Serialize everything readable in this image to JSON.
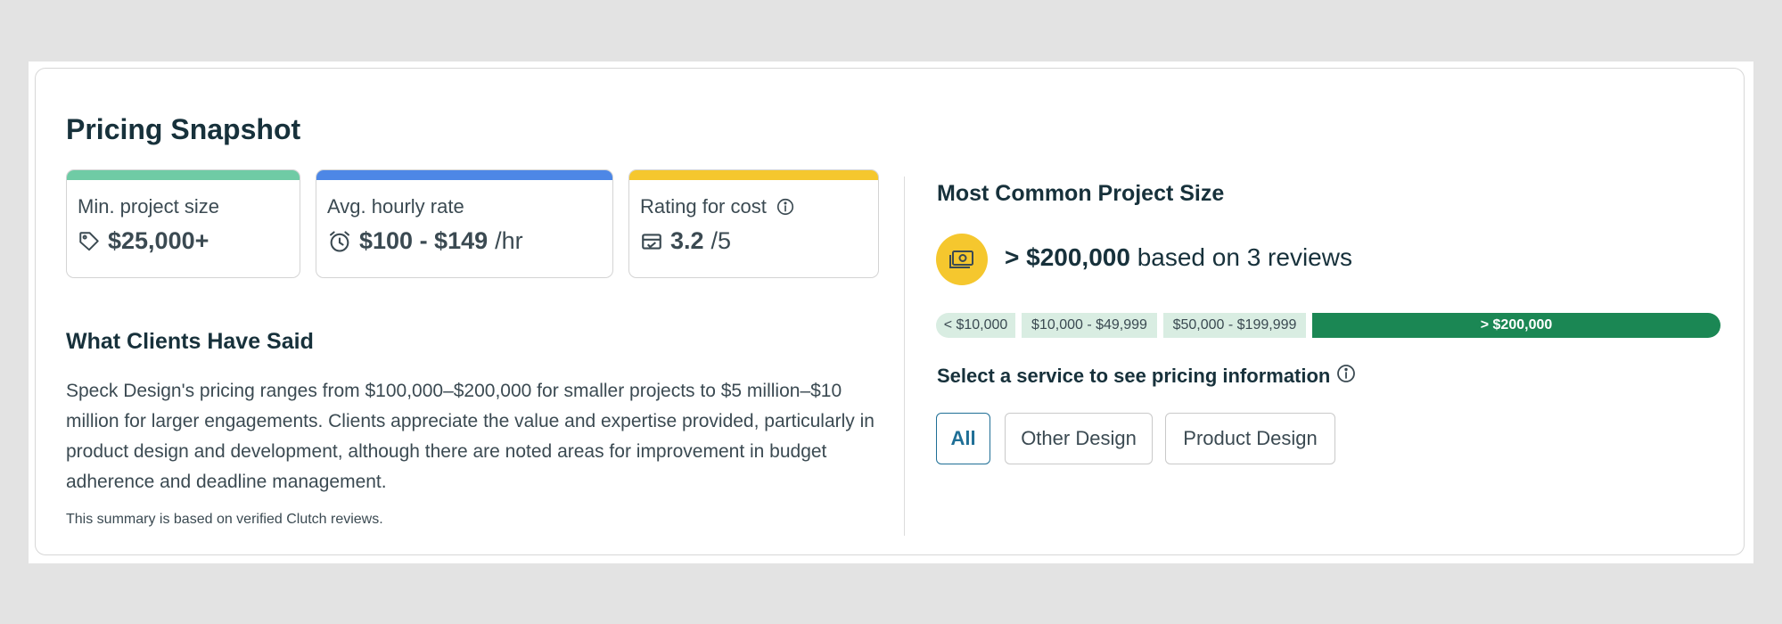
{
  "title": "Pricing Snapshot",
  "stats": [
    {
      "label": "Min. project size",
      "icon": "tag-icon",
      "value": "$25,000+",
      "suffix": "",
      "bar_color": "#6fcba5"
    },
    {
      "label": "Avg. hourly rate",
      "icon": "clock-icon",
      "value": "$100 - $149",
      "suffix": "/hr",
      "bar_color": "#4d87e6"
    },
    {
      "label": "Rating for cost",
      "icon": "wallet-icon",
      "info_icon": "info-icon",
      "value": "3.2",
      "suffix": "/5",
      "bar_color": "#f5c72e"
    }
  ],
  "clients": {
    "heading": "What Clients Have Said",
    "summary": "Speck Design's pricing ranges from $100,000–$200,000 for smaller projects to $5 million–$10 million for larger engagements. Clients appreciate the value and expertise provided, particularly in product design and development, although there are noted areas for improvement in budget adherence and deadline management.",
    "footnote": "This summary is based on verified Clutch reviews."
  },
  "common_size": {
    "heading": "Most Common Project Size",
    "icon": "money-icon",
    "value": "> $200,000",
    "text": "based on 3 reviews",
    "ranges": [
      "< $10,000",
      "$10,000 - $49,999",
      "$50,000 - $199,999",
      "> $200,000"
    ],
    "active_range": "> $200,000",
    "colors": {
      "active": "#1b8754",
      "inactive": "#d9ede2",
      "coin": "#f5c72e"
    }
  },
  "services": {
    "label": "Select a service to see pricing information",
    "info_icon": "info-icon",
    "options": [
      "All",
      "Other Design",
      "Product Design"
    ],
    "selected": "All"
  }
}
